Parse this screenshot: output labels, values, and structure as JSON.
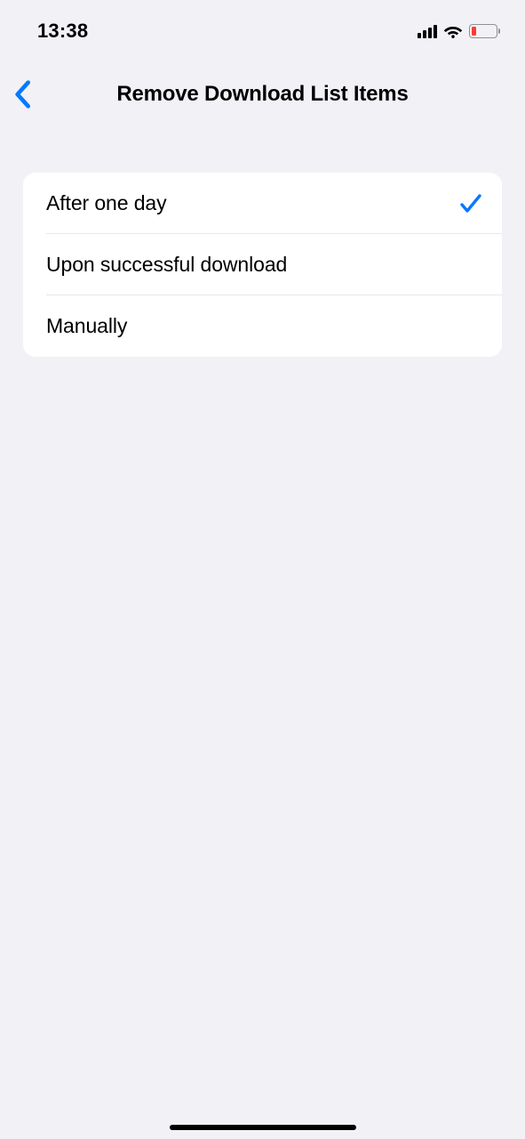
{
  "statusBar": {
    "time": "13:38"
  },
  "nav": {
    "title": "Remove Download List Items"
  },
  "options": [
    {
      "label": "After one day",
      "selected": true
    },
    {
      "label": "Upon successful download",
      "selected": false
    },
    {
      "label": "Manually",
      "selected": false
    }
  ]
}
